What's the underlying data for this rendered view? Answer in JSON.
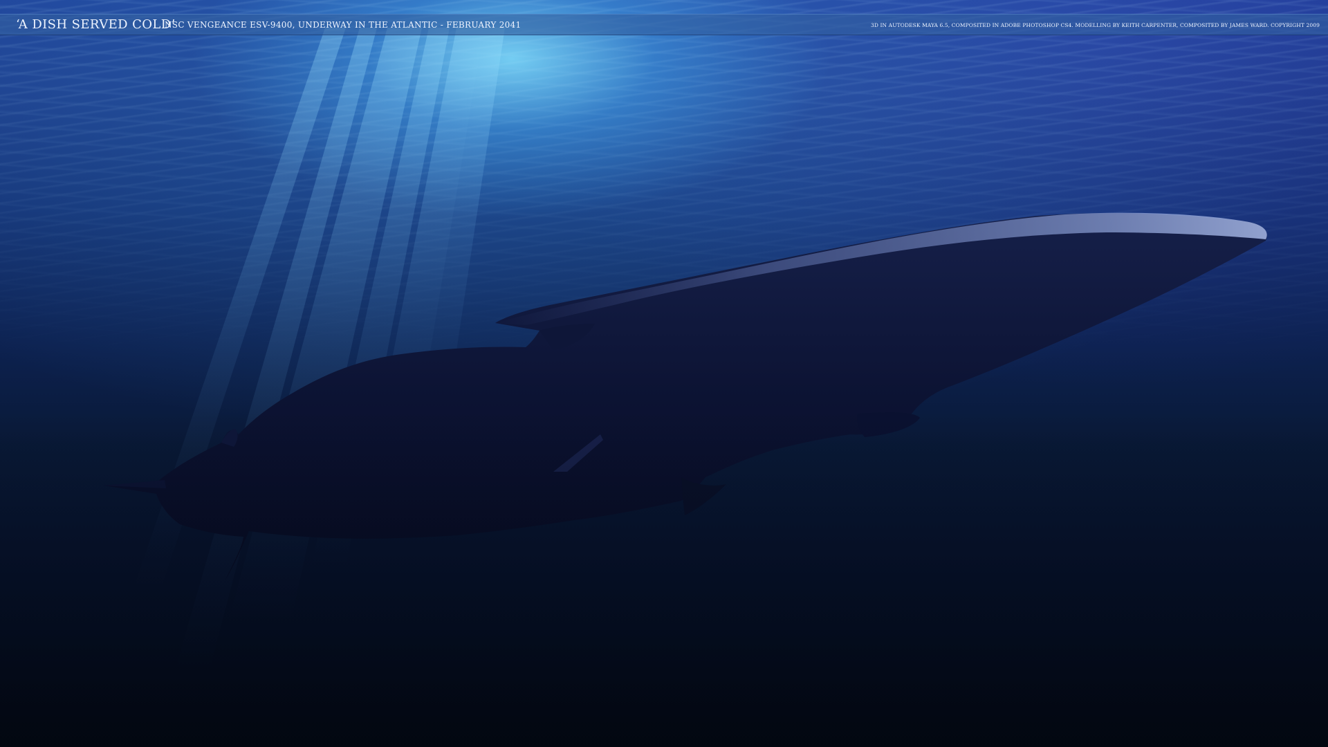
{
  "caption": {
    "title": "‘A DISH SERVED COLD’",
    "subtitle": "NSC VENGEANCE ESV-9400, UNDERWAY IN THE ATLANTIC - FEBRUARY 2041",
    "credits": "3D IN AUTODESK MAYA 6.5, COMPOSITED IN ADOBE PHOTOSHOP CS4. MODELLING BY KEITH CARPENTER, COMPOSITED BY JAMES WARD.   COPYRIGHT 2009"
  },
  "colors": {
    "water_surface": "#1e3f96",
    "sunlight": "#82e1ff",
    "deep_water": "#040b18",
    "submarine_hull": "#0b1230",
    "hull_highlight": "#7f92c6",
    "caption_bar": "#325fa0",
    "caption_text": "#eef4ff"
  }
}
